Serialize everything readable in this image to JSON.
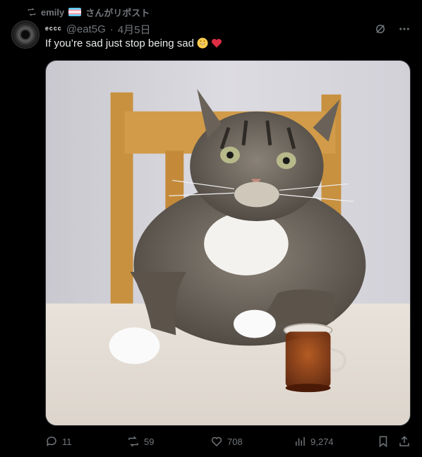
{
  "repost": {
    "name": "emily",
    "suffix": "さんがリポスト"
  },
  "author": {
    "display_name": "ᵉᶜᶜᶜ",
    "handle": "@eat5G",
    "separator": "·",
    "date": "4月5日"
  },
  "tweet": {
    "text": "If you’re sad just stop being sad",
    "emoji": [
      "grinning-face",
      "red-heart"
    ]
  },
  "media": {
    "alt_kind": "photo"
  },
  "actions": {
    "replies": "11",
    "reposts": "59",
    "likes": "708",
    "views": "9,274"
  },
  "colors": {
    "background": "#000000",
    "text": "#e7e9ea",
    "muted": "#71767b"
  },
  "icons": [
    "repost-icon",
    "grok-icon",
    "more-icon",
    "reply-icon",
    "like-icon",
    "views-icon",
    "bookmark-icon",
    "share-icon"
  ]
}
